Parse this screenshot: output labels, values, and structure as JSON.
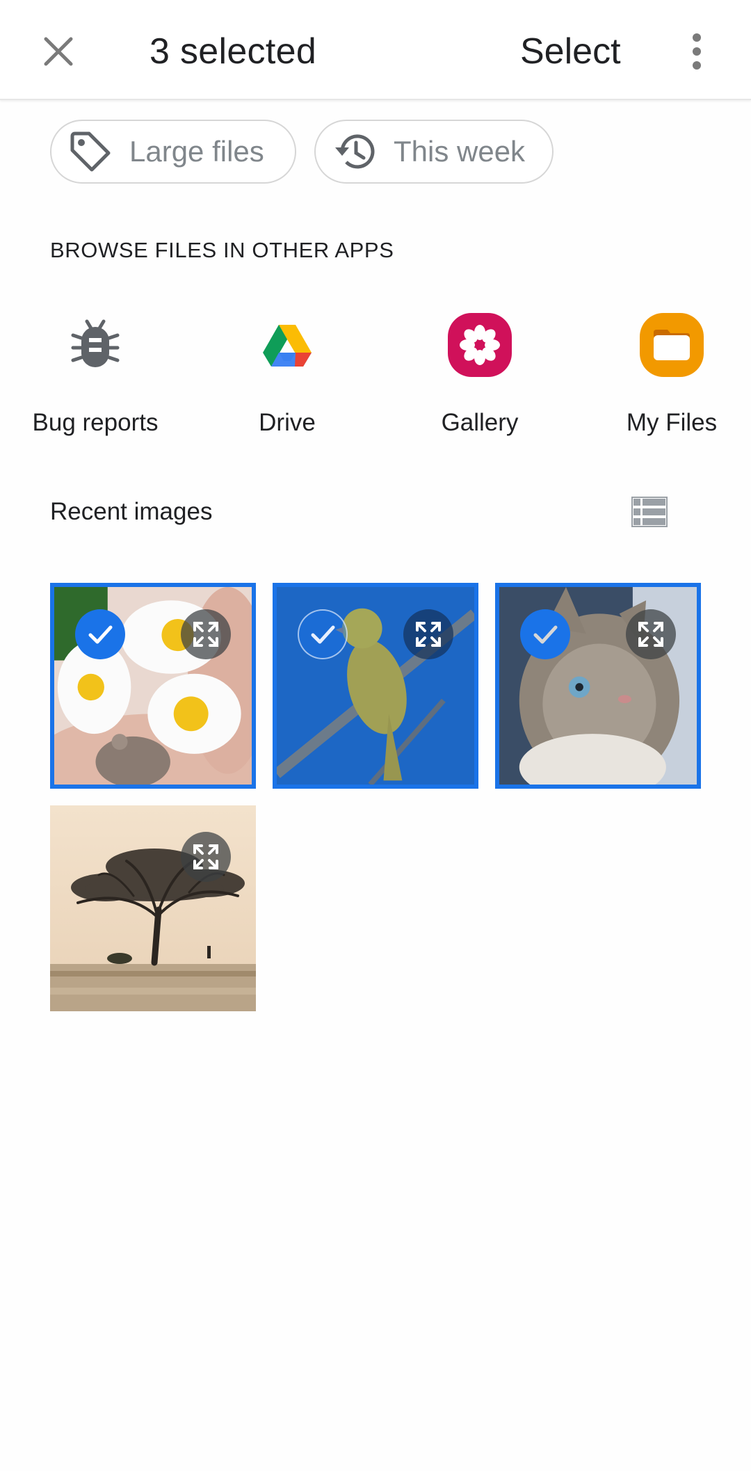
{
  "header": {
    "title": "3 selected",
    "select_label": "Select",
    "close_icon": "close-icon",
    "more_icon": "more-vert-icon"
  },
  "chips": [
    {
      "label": "Large files",
      "icon": "tag-icon"
    },
    {
      "label": "This week",
      "icon": "history-icon"
    }
  ],
  "browse": {
    "heading": "BROWSE FILES IN OTHER APPS",
    "apps": [
      {
        "label": "Bug reports",
        "icon": "bug-icon"
      },
      {
        "label": "Drive",
        "icon": "google-drive-icon"
      },
      {
        "label": "Gallery",
        "icon": "gallery-icon"
      },
      {
        "label": "My Files",
        "icon": "folder-icon"
      }
    ]
  },
  "recent": {
    "heading": "Recent images",
    "view_icon": "list-view-icon",
    "images": [
      {
        "subject": "mouse-daisies",
        "selected": true
      },
      {
        "subject": "yellow-bird",
        "selected": true
      },
      {
        "subject": "kitten",
        "selected": true
      },
      {
        "subject": "tree",
        "selected": false
      }
    ]
  },
  "colors": {
    "accent": "#1a73e8",
    "gallery": "#d0115a",
    "my_files": "#f29900",
    "chip_text": "#80868b"
  }
}
